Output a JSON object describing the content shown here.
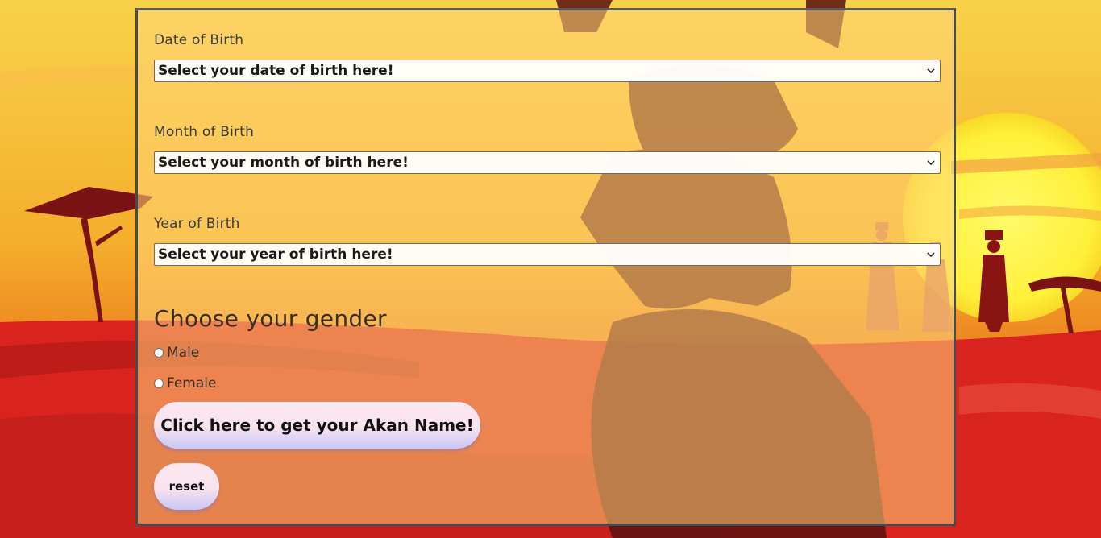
{
  "form": {
    "date_label": "Date of Birth",
    "date_select": "Select your date of birth here!",
    "month_label": "Month of Birth",
    "month_select": "Select your month of birth here!",
    "year_label": "Year of Birth",
    "year_select": "Select your year of birth here!",
    "gender_heading": "Choose your gender",
    "gender_options": [
      {
        "label": "Male",
        "selected": false
      },
      {
        "label": "Female",
        "selected": false
      }
    ],
    "submit_label": "Click here to get your Akan Name!",
    "reset_label": "reset"
  },
  "icons": {
    "select_arrow": "chevron-down-icon",
    "radio": "radio-button-icon"
  },
  "colors": {
    "sky_top": "#f6c335",
    "sky_mid": "#f5a623",
    "ground": "#d8231f",
    "sun": "#fff23a",
    "silhouette": "#8a1414",
    "panel_border": "#4a4a4a",
    "button_top": "#fde8f0",
    "button_bottom": "#c8c8f5"
  }
}
